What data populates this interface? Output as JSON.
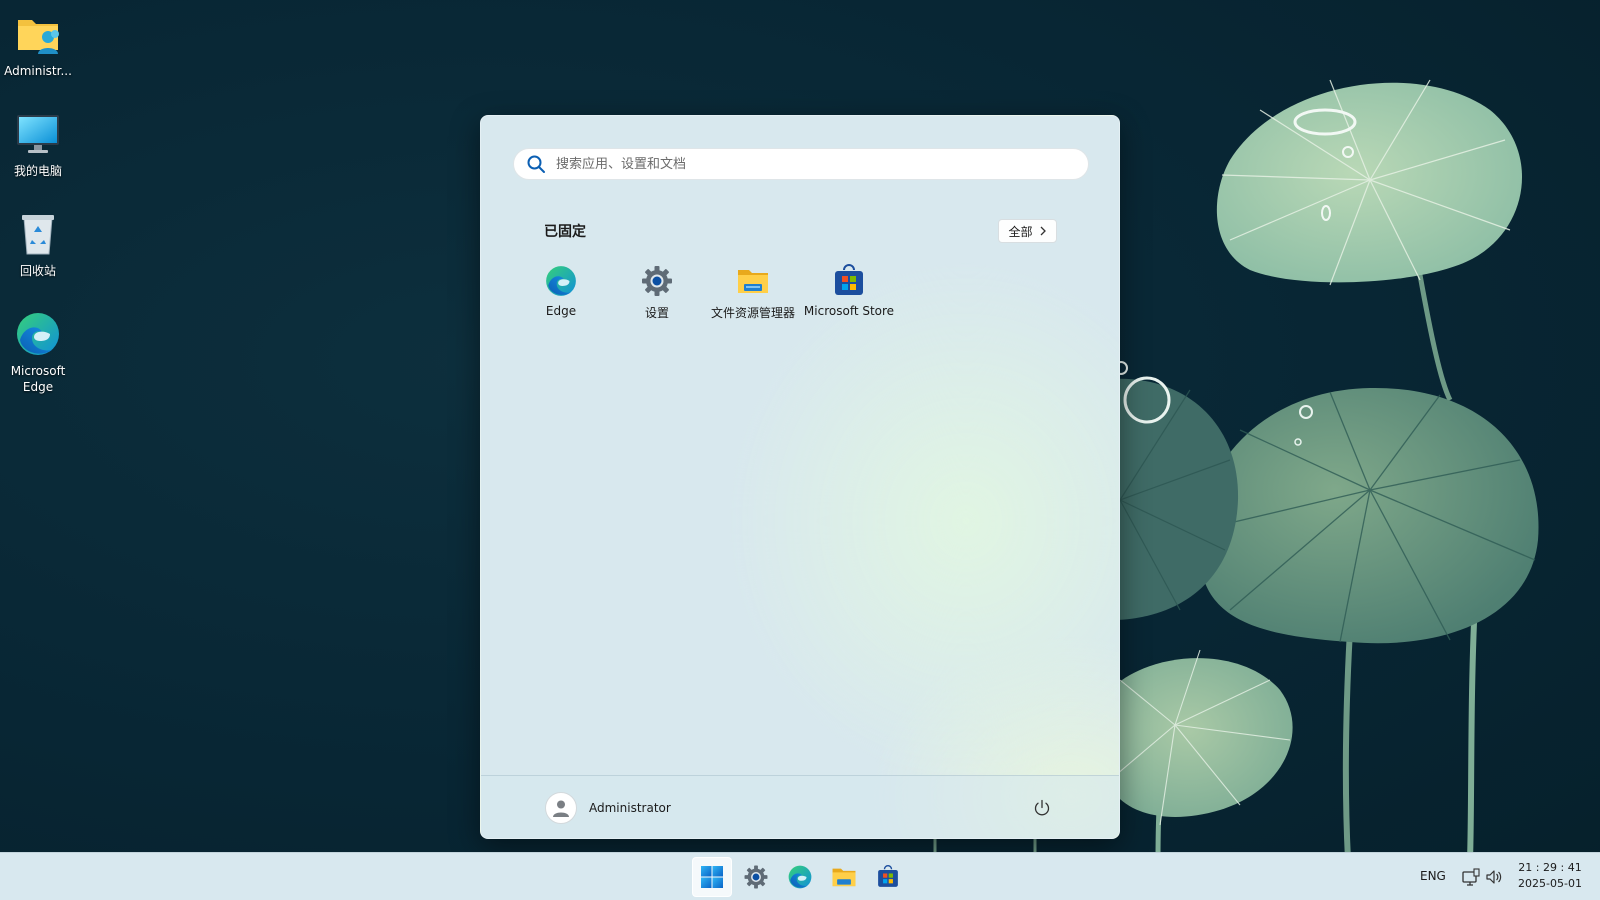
{
  "desktop": {
    "icons": [
      {
        "label": "Administr...",
        "icon": "user-folder-icon"
      },
      {
        "label": "我的电脑",
        "icon": "monitor-icon"
      },
      {
        "label": "回收站",
        "icon": "recycle-bin-icon"
      },
      {
        "label": "Microsoft Edge",
        "icon": "edge-icon"
      }
    ]
  },
  "start_menu": {
    "search": {
      "placeholder": "搜索应用、设置和文档",
      "value": ""
    },
    "pinned": {
      "title": "已固定",
      "all_button": "全部",
      "apps": [
        {
          "label": "Edge",
          "icon": "edge-icon"
        },
        {
          "label": "设置",
          "icon": "gear-icon"
        },
        {
          "label": "文件资源管理器",
          "icon": "folder-icon"
        },
        {
          "label": "Microsoft Store",
          "icon": "store-icon"
        }
      ]
    },
    "footer": {
      "user_name": "Administrator",
      "power_icon": "power-icon"
    }
  },
  "taskbar": {
    "apps": [
      "windows-start-icon",
      "gear-icon",
      "edge-icon",
      "folder-icon",
      "store-icon"
    ],
    "tray": {
      "language": "ENG",
      "time": "21 : 29 : 41",
      "date": "2025-05-01"
    }
  },
  "colors": {
    "desktop_background": "#082634",
    "start_menu_background": "#d8e8ee",
    "taskbar_background": "#d8e8ef",
    "accent": "#0078d4"
  }
}
